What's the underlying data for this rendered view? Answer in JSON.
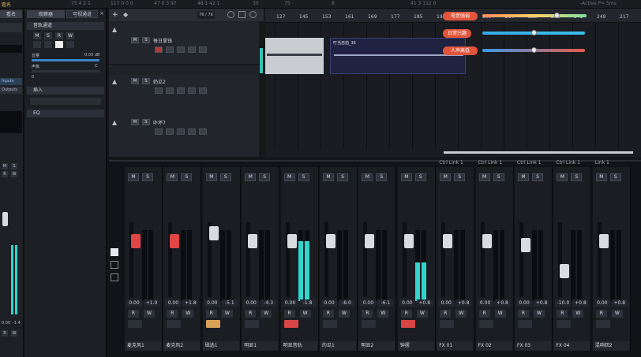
{
  "top_strip": {
    "left_label": "看名",
    "readouts": [
      "75  4  2  1",
      "117  0  0  0",
      "47  0  3  97",
      "48  1  42  1",
      "30",
      "75",
      "8",
      "41 3  112  0"
    ],
    "right_label": "-Active  P=  5ms"
  },
  "left_inspector": {
    "tab_active": "看名",
    "items": [
      {
        "label": "Inputs"
      },
      {
        "label": "Outputs"
      }
    ],
    "values": [
      "0.00",
      "-1.4"
    ],
    "buttons": [
      "M",
      "S",
      "R",
      "W"
    ]
  },
  "inspector": {
    "tabs": [
      "观察器",
      "可视通道"
    ],
    "section_title": "音轨通道",
    "buttons": [
      "M",
      "S",
      "R",
      "W"
    ],
    "volume_label": "音量",
    "volume_value": "0.00 dB",
    "pan_label": "声像",
    "pan_value": "C",
    "sub_value": "0",
    "section2": "插入",
    "section3": "EQ"
  },
  "track_toolbar": {
    "add": "+",
    "count": "76 / 76"
  },
  "tracks": [
    {
      "name": "每日拿钱",
      "buttons": [
        "M",
        "S"
      ]
    },
    {
      "name": "奶瓜2",
      "buttons": [
        "M",
        "S"
      ]
    },
    {
      "name": "卟坏7",
      "buttons": [
        "M",
        "S"
      ]
    }
  ],
  "ruler": {
    "ticks": [
      "127",
      "145",
      "153",
      "161",
      "169",
      "177",
      "185",
      "193",
      "201",
      "209",
      "217",
      "223",
      "233",
      "241",
      "249",
      "217"
    ]
  },
  "clips": [
    {
      "label": ""
    },
    {
      "label": "叮当自拍_36"
    }
  ],
  "overlays": [
    {
      "label": "电音强弱",
      "level": 0.72
    },
    {
      "label": "日常兴趣",
      "level": 0.5
    },
    {
      "label": "人声高低",
      "level": 0.5
    }
  ],
  "mixer": {
    "channels": [
      {
        "name": "麦克风1",
        "val_left": "0.00",
        "val_right": "+1.0",
        "send": "",
        "meter": 0.0,
        "fader_color": "#e04646",
        "fader_pos": 0.25,
        "rec": false
      },
      {
        "name": "麦克风2",
        "val_left": "0.00",
        "val_right": "+1.8",
        "send": "",
        "meter": 0.0,
        "fader_color": "#e04646",
        "fader_pos": 0.25,
        "rec": false
      },
      {
        "name": "磁选1",
        "val_left": "0.00",
        "val_right": "-5.1",
        "send": "",
        "meter": 0.0,
        "fader_color": "#d8dbe0",
        "fader_pos": 0.15,
        "rec": true,
        "rec_color": "#d9a05a"
      },
      {
        "name": "明显1",
        "val_left": "0.00",
        "val_right": "-4.3",
        "send": "",
        "meter": 0.0,
        "fader_color": "#d8dbe0",
        "fader_pos": 0.25,
        "rec": false
      },
      {
        "name": "明显音轨",
        "val_left": "0.00",
        "val_right": "-1.8",
        "send": "",
        "meter": 0.85,
        "fader_color": "#d8dbe0",
        "fader_pos": 0.25,
        "rec": true,
        "rec_color": "#d84545"
      },
      {
        "name": "的瓜1",
        "val_left": "0.00",
        "val_right": "-6.0",
        "send": "",
        "meter": 0.0,
        "fader_color": "#d8dbe0",
        "fader_pos": 0.25,
        "rec": false
      },
      {
        "name": "明显2",
        "val_left": "0.00",
        "val_right": "-6.1",
        "send": "",
        "meter": 0.0,
        "fader_color": "#d8dbe0",
        "fader_pos": 0.25,
        "rec": false
      },
      {
        "name": "钟摆",
        "val_left": "0.00",
        "val_right": "+0.8",
        "send": "",
        "meter": 0.55,
        "fader_color": "#d8dbe0",
        "fader_pos": 0.25,
        "rec": true,
        "rec_color": "#d84545"
      },
      {
        "name": "FX 01",
        "val_left": "0.00",
        "val_right": "+0.8",
        "send": "Ctrl Link 1",
        "meter": 0.0,
        "fader_color": "#d8dbe0",
        "fader_pos": 0.25,
        "rec": false
      },
      {
        "name": "FX 02",
        "val_left": "0.00",
        "val_right": "+0.8",
        "send": "Ctrl Link 1",
        "meter": 0.0,
        "fader_color": "#d8dbe0",
        "fader_pos": 0.25,
        "rec": false
      },
      {
        "name": "FX 03",
        "val_left": "0.00",
        "val_right": "+0.8",
        "send": "Ctrl Link 1",
        "meter": 0.0,
        "fader_color": "#d8dbe0",
        "fader_pos": 0.3,
        "rec": false
      },
      {
        "name": "FX 04",
        "val_left": "-10.0",
        "val_right": "+0.8",
        "send": "Ctrl Link 1",
        "meter": 0.0,
        "fader_color": "#d8dbe0",
        "fader_pos": 0.65,
        "rec": false
      },
      {
        "name": "混响回2",
        "val_left": "0.00",
        "val_right": "+0.8",
        "send": "Link 1",
        "meter": 0.0,
        "fader_color": "#d8dbe0",
        "fader_pos": 0.25,
        "rec": false
      },
      {
        "name": "",
        "val_left": "0.00",
        "val_right": "",
        "send": "",
        "meter": 0.0,
        "fader_color": "#d8dbe0",
        "fader_pos": 0.25,
        "rec": false
      }
    ]
  }
}
